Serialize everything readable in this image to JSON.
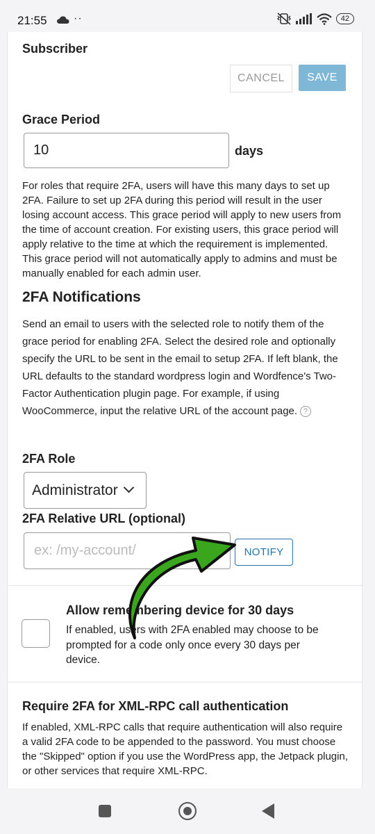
{
  "status_bar": {
    "time": "21:55",
    "dots": "··",
    "battery": "42"
  },
  "form": {
    "role_title": "Subscriber",
    "cancel_label": "CANCEL",
    "save_label": "SAVE",
    "grace_period_label": "Grace Period",
    "grace_period_value": "10",
    "grace_unit": "days",
    "grace_description": "For roles that require 2FA, users will have this many days to set up 2FA. Failure to set up 2FA during this period will result in the user losing account access. This grace period will apply to new users from the time of account creation. For existing users, this grace period will apply relative to the time at which the requirement is implemented. This grace period will not automatically apply to admins and must be manually enabled for each admin user.",
    "notifications_heading": "2FA Notifications",
    "notifications_description": "Send an email to users with the selected role to notify them of the grace period for enabling 2FA. Select the desired role and optionally specify the URL to be sent in the email to setup 2FA. If left blank, the URL defaults to the standard wordpress login and Wordfence's Two-Factor Authentication plugin page. For example, if using WooCommerce, input the relative URL of the account page.",
    "help_glyph": "?",
    "role_label": "2FA Role",
    "role_selected": "Administrator",
    "url_label": "2FA Relative URL (optional)",
    "url_placeholder": "ex: /my-account/",
    "notify_label": "NOTIFY",
    "remember_title": "Allow remembering device for 30 days",
    "remember_description": "If enabled, users with 2FA enabled may choose to be prompted for a code only once every 30 days per device.",
    "xmlrpc_title": "Require 2FA for XML-RPC call authentication",
    "xmlrpc_description": "If enabled, XML-RPC calls that require authentication will also require a valid 2FA code to be appended to the password. You must choose the \"Skipped\" option if you use the WordPress app, the Jetpack plugin, or other services that require XML-RPC."
  },
  "annotation": {
    "arrow_color": "#3aa61e"
  },
  "colors": {
    "save_bg": "#7fb7d6",
    "notify": "#2271b1"
  }
}
